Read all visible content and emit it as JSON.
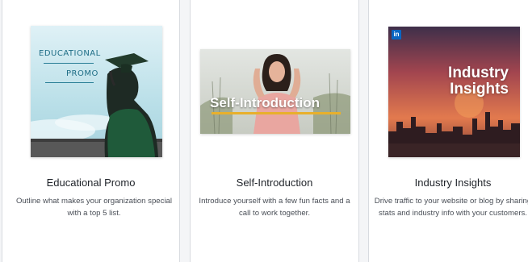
{
  "templates": [
    {
      "title": "Educational Promo",
      "description": "Outline what makes your organization special with a top 5 list.",
      "thumbnail": {
        "overlay_line1": "EDUCATIONAL",
        "overlay_line2": "PROMO"
      }
    },
    {
      "title": "Self-Introduction",
      "description": "Introduce yourself with a few fun facts and a call to work together.",
      "thumbnail": {
        "overlay_text": "Self-Introduction"
      }
    },
    {
      "title": "Industry Insights",
      "description": "Drive traffic to your website or blog by sharing stats and industry info with your customers.",
      "thumbnail": {
        "overlay_line1": "Industry",
        "overlay_line2": "Insights",
        "badge_text": "in",
        "badge_icon": "linkedin-icon"
      }
    }
  ],
  "colors": {
    "background": "#f4f5f7",
    "card": "#ffffff",
    "linkedin_blue": "#0a66c2",
    "accent_yellow": "#e8b02c"
  }
}
